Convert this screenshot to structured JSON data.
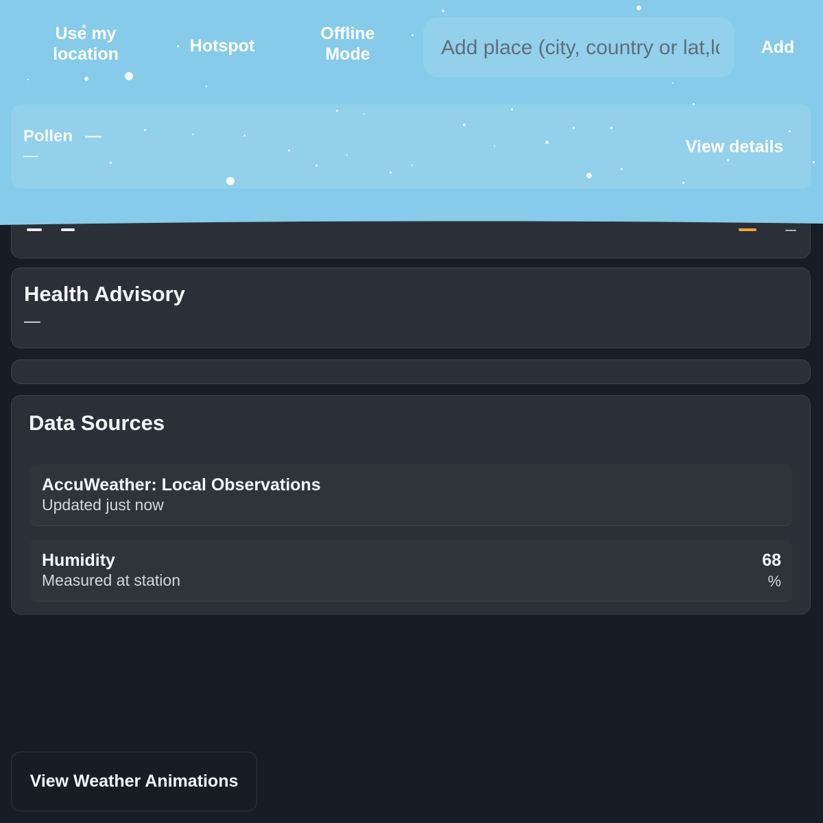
{
  "toolbar": {
    "use_location_label": "Use my location",
    "hotspot_label": "Hotspot",
    "offline_mode_label": "Offline Mode",
    "add_label": "Add"
  },
  "search": {
    "placeholder": "Add place (city, country or lat,lon)"
  },
  "pollen": {
    "label": "Pollen",
    "value": "—",
    "detail": "—",
    "view_details_label": "View details"
  },
  "health_advisory": {
    "title": "Health Advisory",
    "text": "—"
  },
  "data_sources": {
    "title": "Data Sources",
    "items": [
      {
        "title": "AccuWeather: Local Observations",
        "subtitle": "Updated just now"
      },
      {
        "title": "Humidity",
        "subtitle": "Measured at station",
        "value": "68",
        "unit": "%"
      }
    ]
  },
  "footer": {
    "animations_label": "View Weather Animations"
  },
  "colors": {
    "sky": "#86cbe9",
    "background": "#171d25",
    "card": "#2b3038",
    "accent": "#f0a43a"
  }
}
